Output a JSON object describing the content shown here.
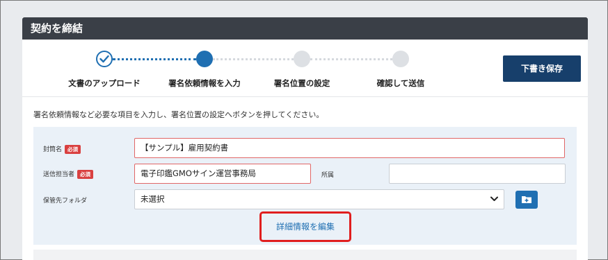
{
  "panel": {
    "title": "契約を締結"
  },
  "stepper": {
    "steps": [
      {
        "label": "文書のアップロード",
        "state": "done"
      },
      {
        "label": "署名依頼情報を入力",
        "state": "active"
      },
      {
        "label": "署名位置の設定",
        "state": "pending"
      },
      {
        "label": "確認して送信",
        "state": "pending"
      }
    ],
    "save_draft_label": "下書き保存"
  },
  "instruction": "署名依頼情報など必要な項目を入力し、署名位置の設定へボタンを押してください。",
  "form": {
    "required_badge": "必須",
    "envelope": {
      "label": "封筒名",
      "value": "【サンプル】雇用契約書"
    },
    "sender": {
      "label": "送信担当者",
      "value": "電子印鑑GMOサイン運営事務局"
    },
    "affiliation": {
      "label": "所属",
      "value": ""
    },
    "folder": {
      "label": "保管先フォルダ",
      "selected": "未選択"
    },
    "detail_link": "詳細情報を編集"
  },
  "colors": {
    "accent": "#1f6fb2",
    "header_bg": "#3a3f47",
    "save_button": "#173f6b",
    "required": "#d94040",
    "highlight": "#e01e1e"
  },
  "icons": [
    "check-icon",
    "chevron-down-icon",
    "folder-plus-icon"
  ]
}
